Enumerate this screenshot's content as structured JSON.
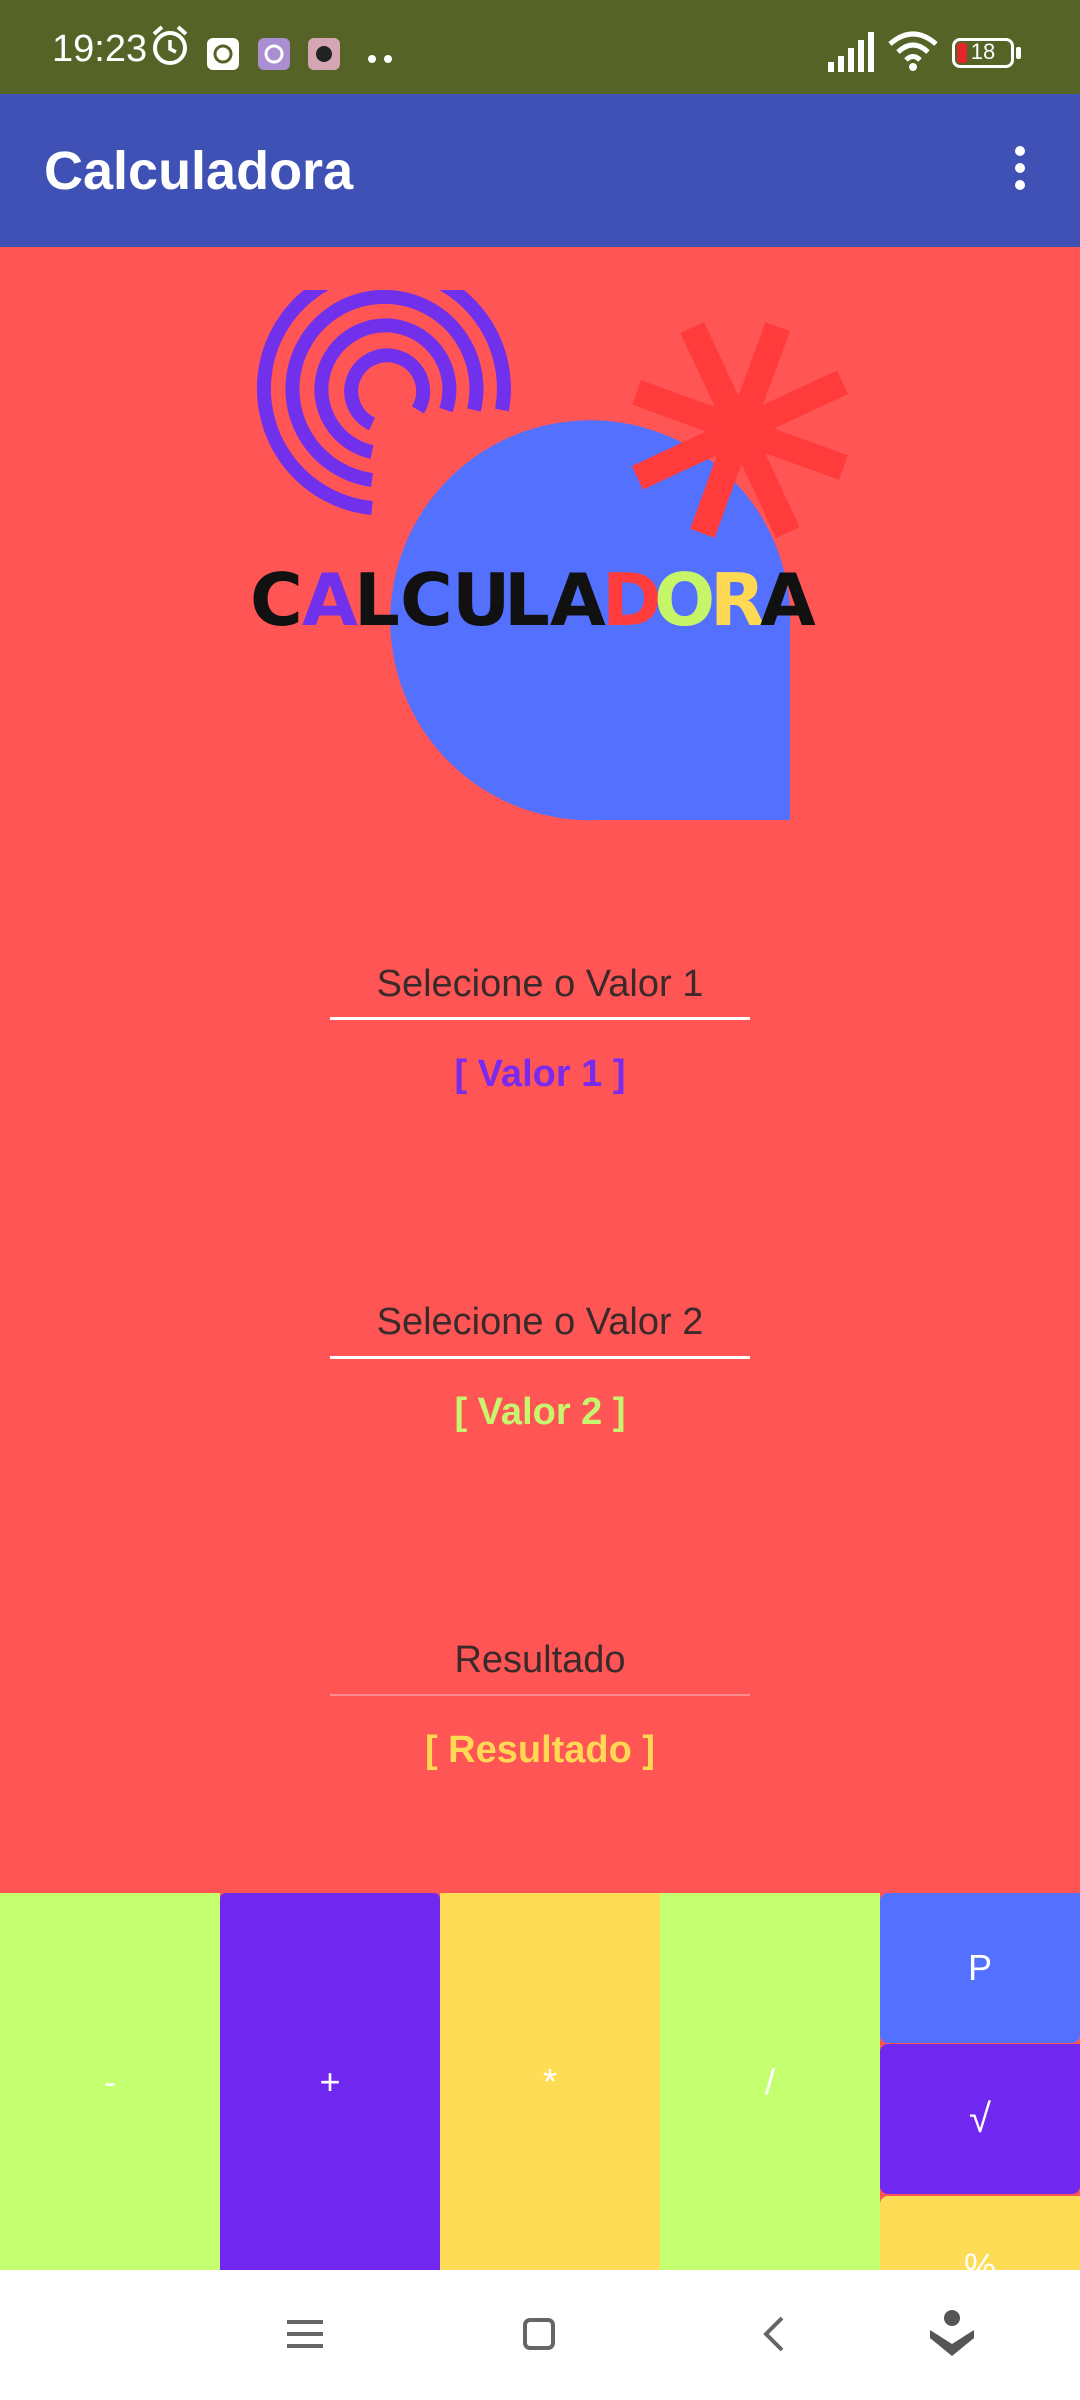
{
  "status_bar": {
    "time": "19:23",
    "battery": "18",
    "icons": [
      "alarm-icon",
      "app-notification-icon",
      "app-notification-icon",
      "app-notification-icon",
      "more-dots-icon",
      "signal-icon",
      "wifi-icon",
      "battery-icon"
    ]
  },
  "app_bar": {
    "title": "Calculadora",
    "menu_icon": "overflow-menu-icon"
  },
  "logo": {
    "letters": [
      "C",
      "A",
      "L",
      "C",
      "U",
      "L",
      "A",
      "D",
      "O",
      "R",
      "A"
    ]
  },
  "fields": [
    {
      "label": "Selecione o Valor 1",
      "value": "[ Valor 1 ]",
      "value_color": "#7a2aee"
    },
    {
      "label": "Selecione o Valor 2",
      "value": "[ Valor 2 ]",
      "value_color": "#c8f56e"
    },
    {
      "label": "Resultado",
      "value": "[ Resultado ]",
      "value_color": "#ffd954"
    }
  ],
  "keys": {
    "minus": "-",
    "plus": "+",
    "multiply": "*",
    "divide": "/",
    "power": "P",
    "sqrt": "√",
    "percent": "%"
  },
  "colors": {
    "background": "#ff5555",
    "app_bar": "#3f51b5",
    "status_bar": "#556326",
    "key_green": "#c4ff70",
    "key_purple": "#7028f0",
    "key_yellow": "#ffdc55",
    "key_blue": "#5370ff"
  },
  "nav_bar": {
    "icons": [
      "recents-icon",
      "home-icon",
      "back-icon",
      "assistant-icon"
    ]
  }
}
